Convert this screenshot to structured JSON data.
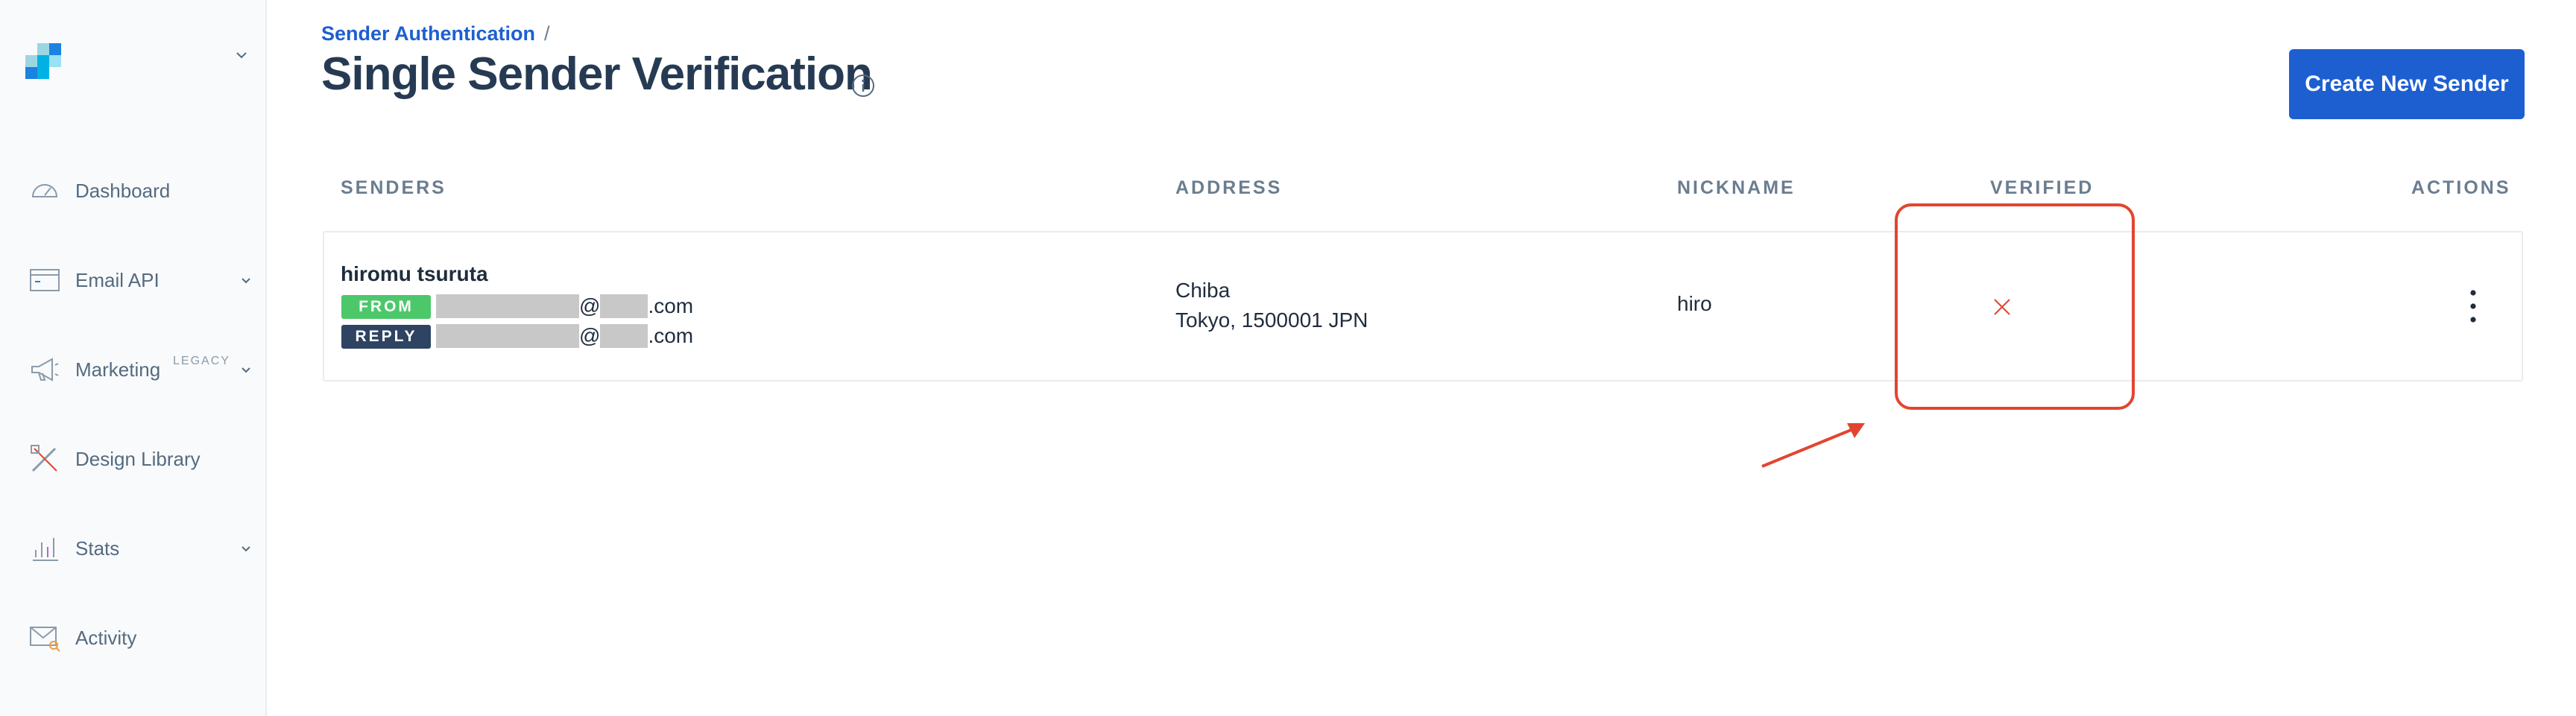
{
  "sidebar": {
    "items": [
      {
        "label": "Dashboard",
        "icon": "gauge-icon",
        "has_chevron": false
      },
      {
        "label": "Email API",
        "icon": "code-window-icon",
        "has_chevron": true
      },
      {
        "label": "Marketing",
        "icon": "megaphone-icon",
        "badge": "LEGACY",
        "has_chevron": true
      },
      {
        "label": "Design Library",
        "icon": "design-tools-icon",
        "has_chevron": false
      },
      {
        "label": "Stats",
        "icon": "bar-chart-icon",
        "has_chevron": true
      },
      {
        "label": "Activity",
        "icon": "mail-search-icon",
        "has_chevron": false
      }
    ]
  },
  "header": {
    "breadcrumb_link": "Sender Authentication",
    "breadcrumb_sep": "/",
    "title": "Single Sender Verification",
    "create_button": "Create New Sender"
  },
  "table": {
    "columns": [
      "SENDERS",
      "ADDRESS",
      "NICKNAME",
      "VERIFIED",
      "ACTIONS"
    ],
    "rows": [
      {
        "name": "hiromu tsuruta",
        "from_tag": "FROM",
        "reply_tag": "REPLY",
        "email_at": "@",
        "email_tld": ".com",
        "address_line1": "Chiba",
        "address_line2": "Tokyo, 1500001 JPN",
        "nickname": "hiro",
        "verified": false
      }
    ]
  },
  "colors": {
    "primary": "#1d5fd1",
    "from_tag": "#4cc86a",
    "reply_tag": "#2f4462",
    "annotation": "#e2452f",
    "unverified": "#e2452f"
  }
}
